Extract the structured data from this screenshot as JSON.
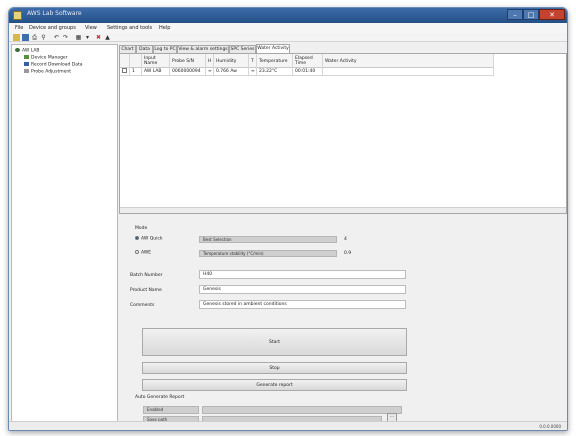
{
  "window": {
    "title": "AWS Lab Software"
  },
  "menu": [
    {
      "label": "File"
    },
    {
      "label": "Device and groups"
    },
    {
      "label": "View"
    },
    {
      "label": "Settings and tools"
    },
    {
      "label": "Help"
    }
  ],
  "tree": {
    "items": [
      {
        "label": "AW LAB",
        "icon": "device-icon"
      },
      {
        "label": "Device Manager",
        "icon": "gear-icon"
      },
      {
        "label": "Record Download Data",
        "icon": "download-icon"
      },
      {
        "label": "Probe Adjustment",
        "icon": "adjust-icon"
      }
    ]
  },
  "tabs": [
    {
      "label": "Chart"
    },
    {
      "label": "Data"
    },
    {
      "label": "Log to PC"
    },
    {
      "label": "View & alarm settings"
    },
    {
      "label": "SPC Series"
    },
    {
      "label": "Water Activity"
    }
  ],
  "grid": {
    "headers": [
      "",
      "",
      "Input Name",
      "Probe S/N",
      "H",
      "Humidity",
      "T",
      "Temperature",
      "Elapsed Time",
      "Water Activity"
    ],
    "row": [
      "",
      "1",
      "AW LAB",
      "0060000094",
      "≈",
      "0.766 Aw",
      "≈",
      "23.22°C",
      "00:01:40",
      ""
    ]
  },
  "form": {
    "mode_label": "Mode",
    "modes": [
      {
        "label": "AW Quick",
        "selected": true,
        "setting": "Best Selection",
        "value": "4"
      },
      {
        "label": "AWE",
        "selected": false,
        "setting": "Temperature stability (°C/min)",
        "value": "0.9"
      }
    ],
    "batch_label": "Batch Number",
    "batch_value": "H40",
    "product_label": "Product Name",
    "product_value": "Genesis",
    "comments_label": "Comments",
    "comments_value": "Genesis stored in ambient conditions",
    "start_label": "Start",
    "stop_label": "Stop",
    "generate_label": "Generate report",
    "auto_report_label": "Auto Generate Report",
    "enabled_label": "Enabled",
    "save_path_label": "Save path",
    "browse_label": "..."
  },
  "status": {
    "text": "0.0.0.0000"
  }
}
